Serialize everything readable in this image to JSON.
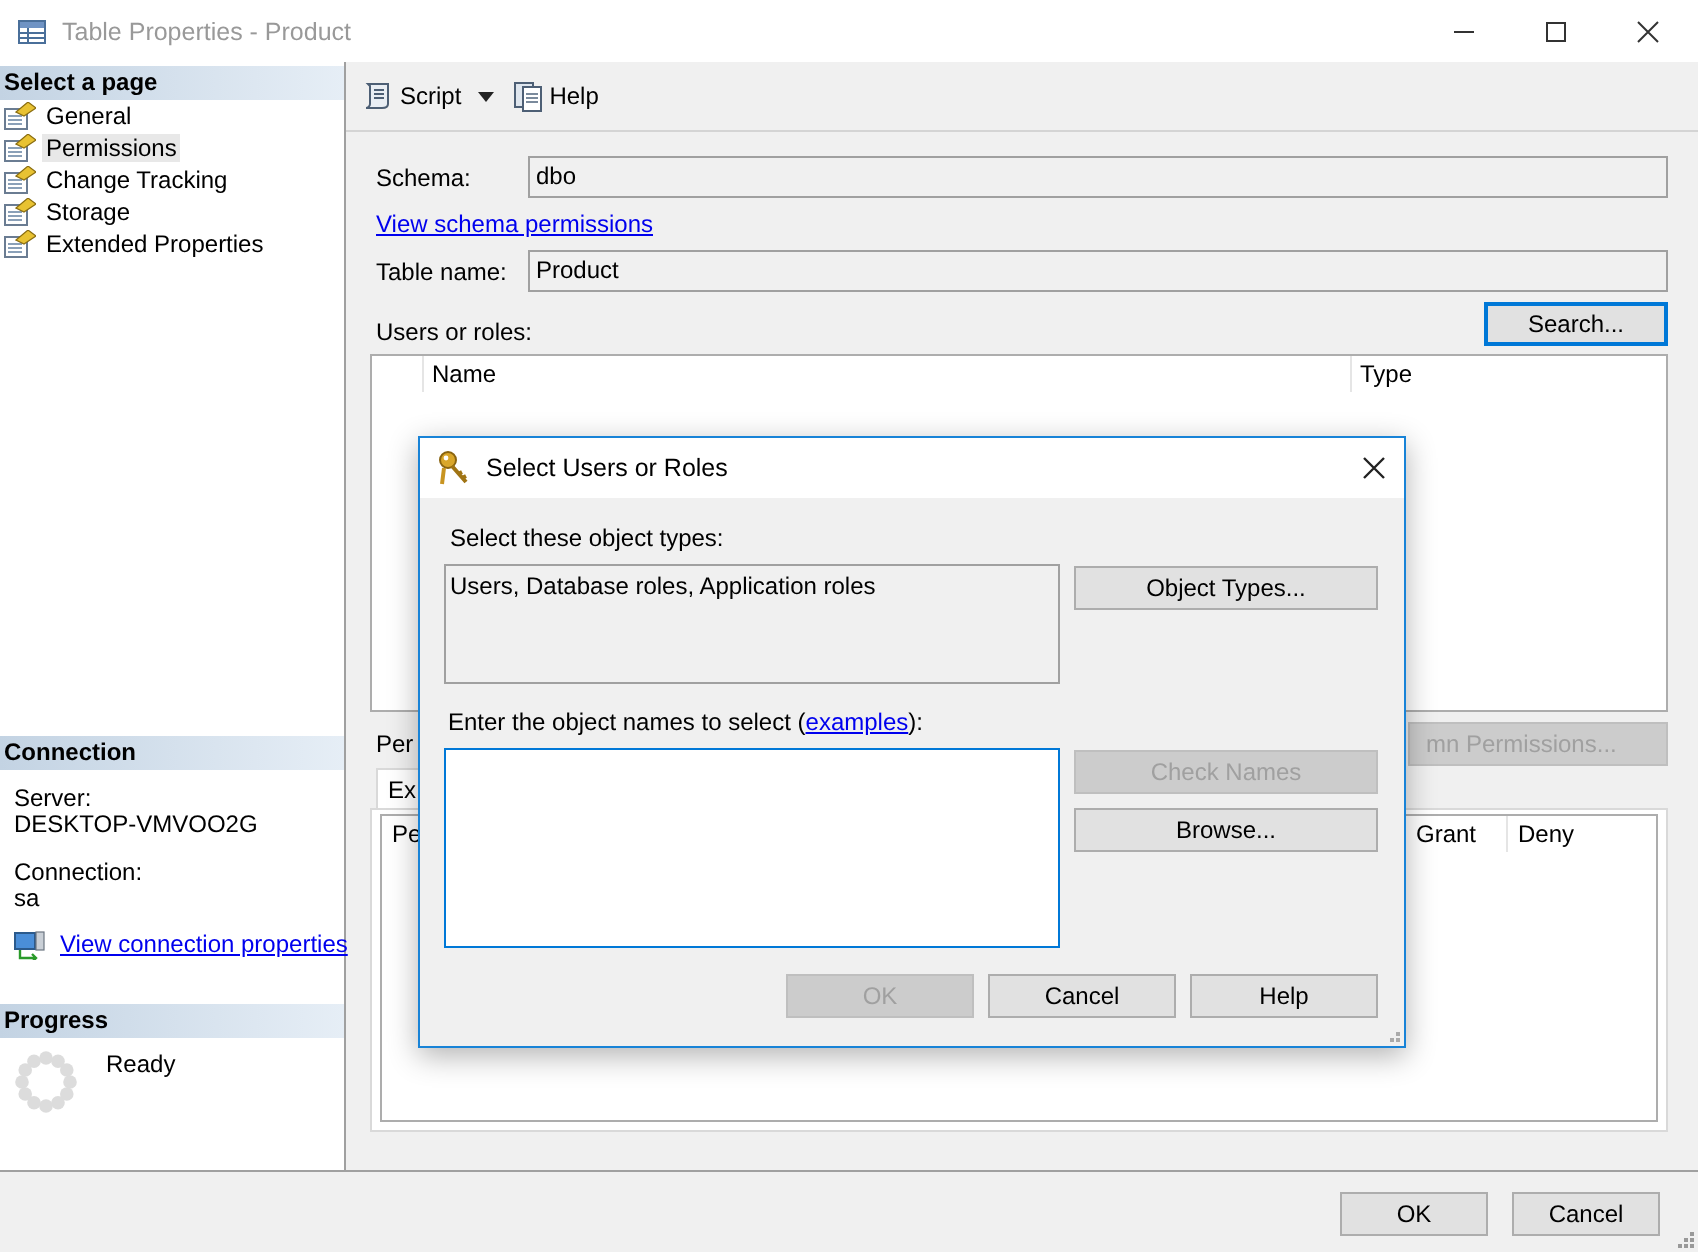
{
  "window": {
    "title": "Table Properties - Product"
  },
  "sidebar": {
    "header": "Select a page",
    "pages": [
      {
        "label": "General",
        "selected": false
      },
      {
        "label": "Permissions",
        "selected": true
      },
      {
        "label": "Change Tracking",
        "selected": false
      },
      {
        "label": "Storage",
        "selected": false
      },
      {
        "label": "Extended Properties",
        "selected": false
      }
    ]
  },
  "connection": {
    "header": "Connection",
    "server_label": "Server:",
    "server": "DESKTOP-VMVOO2G",
    "connection_label": "Connection:",
    "connection": "sa",
    "link": "View connection properties"
  },
  "progress": {
    "header": "Progress",
    "status": "Ready"
  },
  "toolbar": [
    {
      "label": "Script",
      "kind": "dropdown"
    },
    {
      "label": "Help",
      "kind": "button"
    }
  ],
  "form": {
    "schema_label": "Schema:",
    "schema": "dbo",
    "schema_link": "View schema permissions",
    "table_label": "Table name:",
    "table": "Product",
    "users_label": "Users or roles:",
    "search_button": "Search..."
  },
  "users_table": {
    "columns": [
      "Name",
      "Type"
    ]
  },
  "permissions": {
    "label": "Per",
    "column_button": "mn Permissions...",
    "tabs": [
      {
        "label": "Ex",
        "selected": true
      }
    ],
    "columns": [
      "Pe",
      "Grant",
      "Deny"
    ]
  },
  "dialog": {
    "title": "Select Users or Roles",
    "types_label": "Select these object types:",
    "types": "Users, Database roles, Application roles",
    "object_types_button": "Object Types...",
    "names_label_before": "Enter the object names to select (",
    "names_link": "examples",
    "names_label_after": "):",
    "side_buttons": [
      {
        "label": "Check Names",
        "disabled": true
      },
      {
        "label": "Browse...",
        "disabled": false
      }
    ],
    "buttons": [
      {
        "label": "OK",
        "disabled": true
      },
      {
        "label": "Cancel",
        "disabled": false
      },
      {
        "label": "Help",
        "disabled": false
      }
    ]
  },
  "buttons": [
    "OK",
    "Cancel"
  ]
}
